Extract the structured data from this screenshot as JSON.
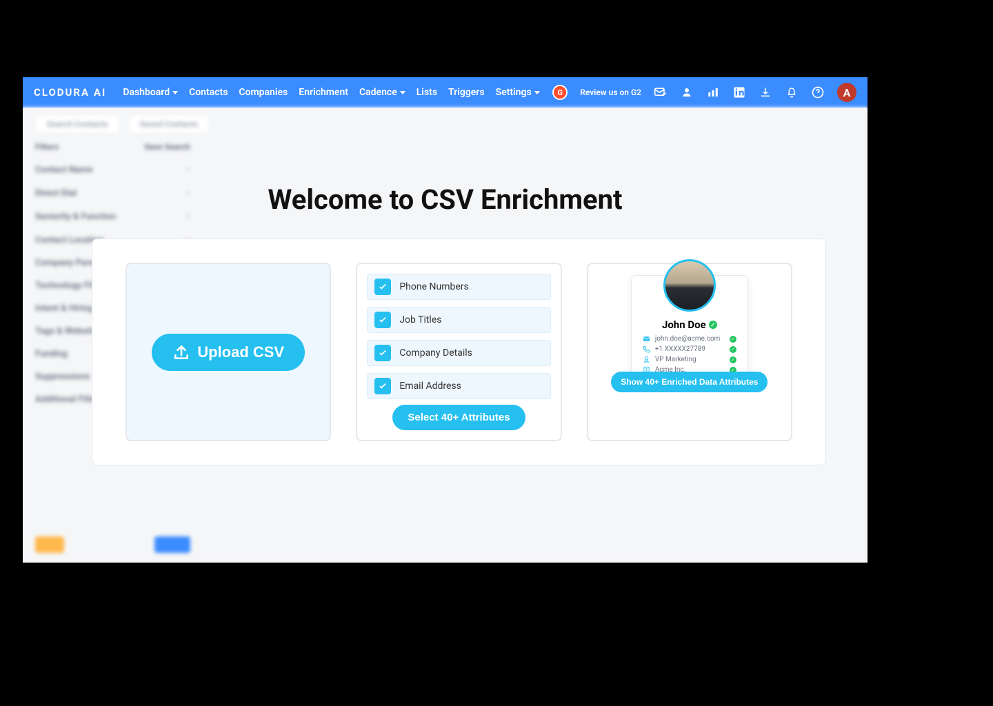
{
  "brand": "CLODURA AI",
  "nav": {
    "dashboard": "Dashboard",
    "contacts": "Contacts",
    "companies": "Companies",
    "enrichment": "Enrichment",
    "cadence": "Cadence",
    "lists": "Lists",
    "triggers": "Triggers",
    "settings": "Settings",
    "review": "Review us on G2",
    "avatar_initial": "A"
  },
  "sidebar": {
    "tab1": "Search Contacts",
    "tab2": "Saved Contacts",
    "filters": "Filters",
    "save_search": "Save Search",
    "items": [
      "Contact Name",
      "Direct Dial",
      "Seniority & Function",
      "Contact Location",
      "Company Parent",
      "Technology Filter",
      "Intent & Hiring",
      "Tags & Website",
      "Funding",
      "Suppressions",
      "Additional Filter"
    ]
  },
  "page_title": "Welcome to CSV Enrichment",
  "upload_btn": "Upload CSV",
  "attributes": [
    "Phone Numbers",
    "Job Titles",
    "Company Details",
    "Email Address"
  ],
  "select_btn": "Select 40+ Attributes",
  "profile": {
    "name": "John Doe",
    "email": "john.doe@acme.com",
    "phone": "+1 XXXXX27789",
    "title": "VP Marketing",
    "company": "Acme Inc."
  },
  "show_btn": "Show 40+ Enriched Data Attributes"
}
